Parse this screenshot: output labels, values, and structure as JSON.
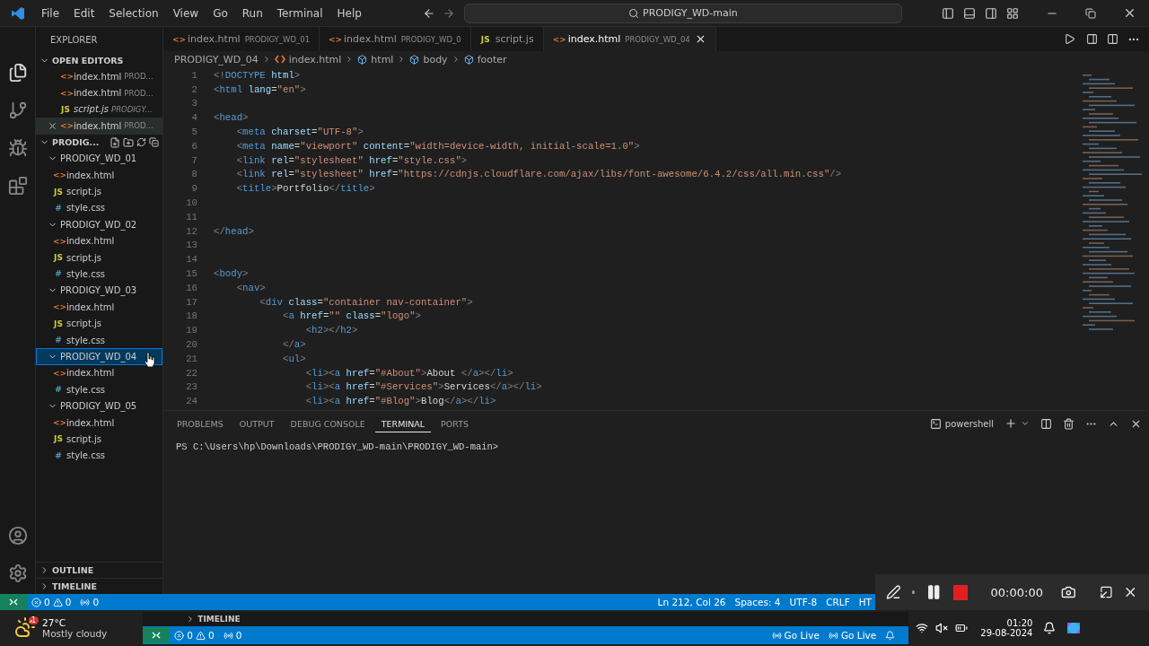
{
  "menu": [
    "File",
    "Edit",
    "Selection",
    "View",
    "Go",
    "Run",
    "Terminal",
    "Help"
  ],
  "command_center": "PRODIGY_WD-main",
  "explorer": {
    "title": "EXPLORER",
    "open_editors": {
      "title": "OPEN EDITORS",
      "expanded": true,
      "items": [
        {
          "kind": "html",
          "icon": "<>",
          "name": "index.html",
          "path": "PROD...",
          "italic": false,
          "selected": false
        },
        {
          "kind": "html",
          "icon": "<>",
          "name": "index.html",
          "path": "PROD...",
          "italic": false,
          "selected": false
        },
        {
          "kind": "js",
          "icon": "JS",
          "name": "script.js",
          "path": "PRODIGY...",
          "italic": true,
          "selected": false
        },
        {
          "kind": "html",
          "icon": "<>",
          "name": "index.html",
          "path": "PROD...",
          "italic": false,
          "selected": true
        }
      ]
    },
    "workspace": {
      "title": "PRODIG...",
      "expanded": true,
      "children": [
        {
          "name": "PRODIGY_WD_01",
          "expanded": true,
          "selected": false,
          "children": [
            {
              "kind": "html",
              "icon": "<>",
              "name": "index.html"
            },
            {
              "kind": "js",
              "icon": "JS",
              "name": "script.js"
            },
            {
              "kind": "css",
              "icon": "#",
              "name": "style.css"
            }
          ]
        },
        {
          "name": "PRODIGY_WD_02",
          "expanded": true,
          "selected": false,
          "children": [
            {
              "kind": "html",
              "icon": "<>",
              "name": "index.html"
            },
            {
              "kind": "js",
              "icon": "JS",
              "name": "script.js"
            },
            {
              "kind": "css",
              "icon": "#",
              "name": "style.css"
            }
          ]
        },
        {
          "name": "PRODIGY_WD_03",
          "expanded": true,
          "selected": false,
          "children": [
            {
              "kind": "html",
              "icon": "<>",
              "name": "index.html"
            },
            {
              "kind": "js",
              "icon": "JS",
              "name": "script.js"
            },
            {
              "kind": "css",
              "icon": "#",
              "name": "style.css"
            }
          ]
        },
        {
          "name": "PRODIGY_WD_04",
          "expanded": true,
          "selected": true,
          "children": [
            {
              "kind": "html",
              "icon": "<>",
              "name": "index.html"
            },
            {
              "kind": "css",
              "icon": "#",
              "name": "style.css"
            }
          ]
        },
        {
          "name": "PRODIGY_WD_05",
          "expanded": true,
          "selected": false,
          "children": [
            {
              "kind": "html",
              "icon": "<>",
              "name": "index.html"
            },
            {
              "kind": "js",
              "icon": "JS",
              "name": "script.js"
            },
            {
              "kind": "css",
              "icon": "#",
              "name": "style.css"
            }
          ]
        }
      ]
    },
    "sections": [
      {
        "title": "OUTLINE",
        "expanded": false
      },
      {
        "title": "TIMELINE",
        "expanded": false
      }
    ]
  },
  "tabs": [
    {
      "kind": "html",
      "icon": "<>",
      "name": "index.html",
      "desc": "PRODIGY_WD_01",
      "selected": false
    },
    {
      "kind": "html",
      "icon": "<>",
      "name": "index.html",
      "desc": "PRODIGY_WD_0",
      "selected": false
    },
    {
      "kind": "js",
      "icon": "JS",
      "name": "script.js",
      "selected": false
    },
    {
      "kind": "html",
      "icon": "<>",
      "name": "index.html",
      "desc": "PRODIGY_WD_04",
      "selected": true
    }
  ],
  "breadcrumb": [
    "PRODIGY_WD_04",
    "index.html",
    "html",
    "body",
    "footer"
  ],
  "code": [
    {
      "n": "1",
      "text": "<!DOCTYPE html>"
    },
    {
      "n": "2",
      "text": "<html lang=\"en\">"
    },
    {
      "n": "3"
    },
    {
      "n": "4",
      "text": "<head>"
    },
    {
      "n": "5",
      "text": "    <meta charset=\"UTF-8\">"
    },
    {
      "n": "6",
      "text": "    <meta name=\"viewport\" content=\"width=device-width, initial-scale=1.0\">"
    },
    {
      "n": "7",
      "text": "    <link rel=\"stylesheet\" href=\"style.css\">"
    },
    {
      "n": "8",
      "text": "    <link rel=\"stylesheet\" href=\"https://cdnjs.cloudflare.com/ajax/libs/font-awesome/6.4.2/css/all.min.css\"/>"
    },
    {
      "n": "9",
      "text": "    <title>Portfolio</title>"
    },
    {
      "n": "10"
    },
    {
      "n": "11"
    },
    {
      "n": "12",
      "text": "</head>"
    },
    {
      "n": "13"
    },
    {
      "n": "14"
    },
    {
      "n": "15",
      "text": "<body>"
    },
    {
      "n": "16",
      "text": "    <nav>"
    },
    {
      "n": "17",
      "text": "        <div class=\"container nav-container\">"
    },
    {
      "n": "18",
      "text": "            <a href=\"\" class=\"logo\">"
    },
    {
      "n": "19",
      "text": "                <h2></h2>"
    },
    {
      "n": "20",
      "text": "            </a>"
    },
    {
      "n": "21",
      "text": "            <ul>"
    },
    {
      "n": "22",
      "text": "                <li><a href=\"#About\">About </a></li>"
    },
    {
      "n": "23",
      "text": "                <li><a href=\"#Services\">Services</a></li>"
    },
    {
      "n": "24",
      "text": "                <li><a href=\"#Blog\">Blog</a></li>"
    }
  ],
  "panel": {
    "tabs": [
      {
        "label": "PROBLEMS",
        "selected": false
      },
      {
        "label": "OUTPUT",
        "selected": false
      },
      {
        "label": "DEBUG CONSOLE",
        "selected": false
      },
      {
        "label": "TERMINAL",
        "selected": true
      },
      {
        "label": "PORTS",
        "selected": false
      }
    ],
    "shell": "powershell",
    "prompt": "PS C:\\Users\\hp\\Downloads\\PRODIGY_WD-main\\PRODIGY_WD-main>"
  },
  "status_bar": {
    "errors": "0",
    "warnings": "0",
    "ports": "0",
    "right": [
      "Ln 212, Col 26",
      "Spaces: 4",
      "UTF-8",
      "CRLF",
      "HT"
    ]
  },
  "recorder": {
    "time": "00:00:00"
  },
  "taskbar": {
    "weather": {
      "badge": "1",
      "temp": "27°C",
      "desc": "Mostly cloudy"
    },
    "mirror": {
      "timeline": "TIMELINE",
      "errors": "0",
      "warnings": "0",
      "ports": "0",
      "right": [
        "Go Live",
        "Go Live"
      ]
    },
    "time": "01:20",
    "date": "29-08-2024"
  }
}
